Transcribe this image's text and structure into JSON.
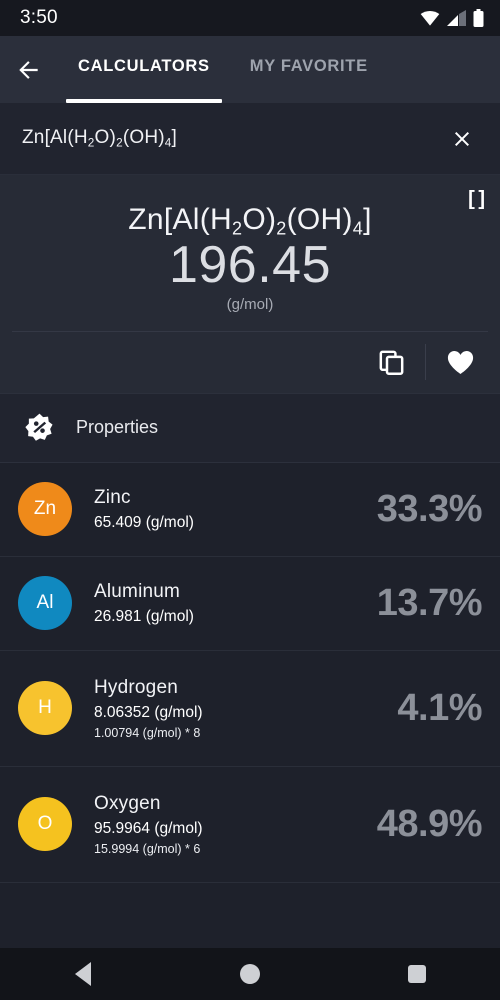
{
  "status_bar": {
    "time": "3:50",
    "icons": [
      "wifi-icon",
      "cell-signal-icon",
      "battery-icon"
    ]
  },
  "app_bar": {
    "back_icon": "arrow-back-icon",
    "tabs": [
      {
        "label": "CALCULATORS",
        "active": true
      },
      {
        "label": "MY FAVORITE",
        "active": false
      }
    ]
  },
  "search": {
    "value": "Zn[Al(H2O)2(OH)4]",
    "value_parts": [
      {
        "t": "Zn[Al(H",
        "sub": false
      },
      {
        "t": "2",
        "sub": true
      },
      {
        "t": "O)",
        "sub": false
      },
      {
        "t": "2",
        "sub": true
      },
      {
        "t": "(OH)",
        "sub": false
      },
      {
        "t": "4",
        "sub": true
      },
      {
        "t": "]",
        "sub": false
      }
    ],
    "clear_icon": "close-icon"
  },
  "result": {
    "bracket_label": "[ ]",
    "formula_plain": "Zn[Al(H2O)2(OH)4]",
    "formula_parts": [
      {
        "t": "Zn[Al(H",
        "sub": false
      },
      {
        "t": "2",
        "sub": true
      },
      {
        "t": "O)",
        "sub": false
      },
      {
        "t": "2",
        "sub": true
      },
      {
        "t": "(OH)",
        "sub": false
      },
      {
        "t": "4",
        "sub": true
      },
      {
        "t": "]",
        "sub": false
      }
    ],
    "molar_mass": "196.45",
    "unit": "(g/mol)",
    "copy_icon": "copy-icon",
    "favorite_icon": "heart-filled-icon"
  },
  "properties": {
    "icon": "percent-badge-icon",
    "title": "Properties",
    "elements": [
      {
        "symbol": "Zn",
        "name": "Zinc",
        "mass": "65.409 (g/mol)",
        "detail": "",
        "percent": "33.3%",
        "color": "#ef8a1a"
      },
      {
        "symbol": "Al",
        "name": "Aluminum",
        "mass": "26.981 (g/mol)",
        "detail": "",
        "percent": "13.7%",
        "color": "#1089c0"
      },
      {
        "symbol": "H",
        "name": "Hydrogen",
        "mass": "8.06352 (g/mol)",
        "detail": "1.00794 (g/mol) * 8",
        "percent": "4.1%",
        "color": "#f7c32e"
      },
      {
        "symbol": "O",
        "name": "Oxygen",
        "mass": "95.9964 (g/mol)",
        "detail": "15.9994 (g/mol) * 6",
        "percent": "48.9%",
        "color": "#f5c21f"
      }
    ]
  },
  "nav_bar": {
    "back_icon": "nav-back-triangle-icon",
    "home_icon": "nav-home-circle-icon",
    "recents_icon": "nav-recents-square-icon"
  }
}
